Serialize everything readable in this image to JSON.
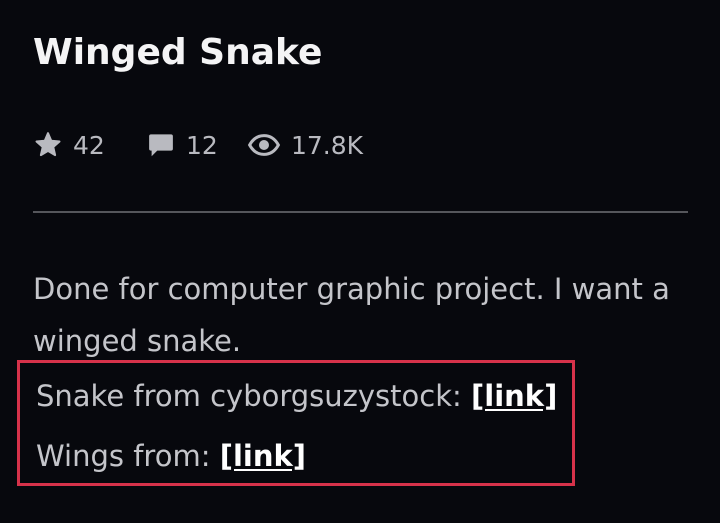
{
  "post": {
    "title": "Winged Snake"
  },
  "stats": {
    "favorites": "42",
    "comments": "12",
    "views": "17.8K",
    "icons": [
      "star-icon",
      "comment-icon",
      "eye-icon"
    ]
  },
  "description": {
    "text": "Done for computer graphic project. I want a winged snake."
  },
  "credits": {
    "snake_prefix": "Snake from cyborgsuzystock: ",
    "snake_link": "[link]",
    "wings_prefix": "Wings from: ",
    "wings_link": "[link]",
    "highlight_color": "#d6324a"
  },
  "colors": {
    "background": "#07080d",
    "title": "#f4f4f5",
    "text": "#c4c5ca"
  }
}
